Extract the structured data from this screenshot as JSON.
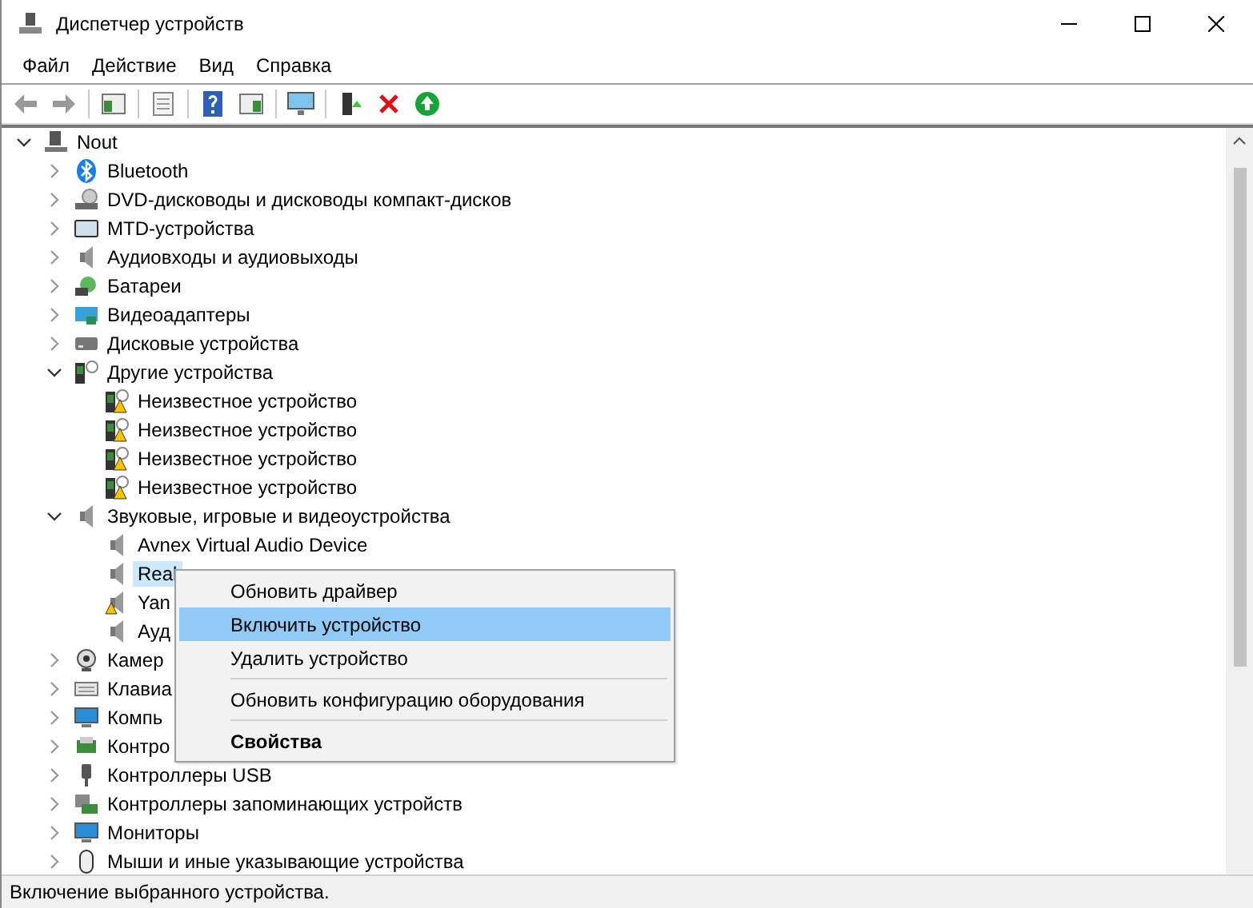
{
  "window": {
    "title": "Диспетчер устройств"
  },
  "menu": [
    "Файл",
    "Действие",
    "Вид",
    "Справка"
  ],
  "toolbar": [
    {
      "kind": "back",
      "disabled": true
    },
    {
      "kind": "forward",
      "disabled": true
    },
    {
      "kind": "sep"
    },
    {
      "kind": "panel"
    },
    {
      "kind": "sep"
    },
    {
      "kind": "sheet"
    },
    {
      "kind": "sep"
    },
    {
      "kind": "help"
    },
    {
      "kind": "panel2"
    },
    {
      "kind": "sep"
    },
    {
      "kind": "monitor"
    },
    {
      "kind": "sep"
    },
    {
      "kind": "driver"
    },
    {
      "kind": "remove"
    },
    {
      "kind": "enable"
    }
  ],
  "tree": [
    {
      "label": "Nout",
      "kind": "computer",
      "expanded": true,
      "selected": false,
      "children": [
        {
          "label": "Bluetooth",
          "kind": "bluetooth",
          "expanded": false,
          "selected": false
        },
        {
          "label": "DVD-дисководы и дисководы компакт-дисков",
          "kind": "dvd",
          "expanded": false,
          "selected": false
        },
        {
          "label": "MTD-устройства",
          "kind": "mtd",
          "expanded": false,
          "selected": false
        },
        {
          "label": "Аудиовходы и аудиовыходы",
          "kind": "speaker",
          "expanded": false,
          "selected": false
        },
        {
          "label": "Батареи",
          "kind": "battery",
          "expanded": false,
          "selected": false
        },
        {
          "label": "Видеоадаптеры",
          "kind": "display",
          "expanded": false,
          "selected": false
        },
        {
          "label": "Дисковые устройства",
          "kind": "disk",
          "expanded": false,
          "selected": false
        },
        {
          "label": "Другие устройства",
          "kind": "unknown",
          "expanded": true,
          "selected": false,
          "children": [
            {
              "label": "Неизвестное устройство",
              "kind": "unknown-warning",
              "selected": false
            },
            {
              "label": "Неизвестное устройство",
              "kind": "unknown-warning",
              "selected": false
            },
            {
              "label": "Неизвестное устройство",
              "kind": "unknown-warning",
              "selected": false
            },
            {
              "label": "Неизвестное устройство",
              "kind": "unknown-warning",
              "selected": false
            }
          ]
        },
        {
          "label": "Звуковые, игровые и видеоустройства",
          "kind": "speaker",
          "expanded": true,
          "selected": false,
          "children": [
            {
              "label": "Avnex Virtual Audio Device",
              "kind": "speaker",
              "selected": false
            },
            {
              "label": "Real",
              "kind": "speaker",
              "selected": true
            },
            {
              "label": "Yan",
              "kind": "speaker-warning",
              "selected": false
            },
            {
              "label": "Ауд",
              "kind": "speaker",
              "selected": false
            }
          ]
        },
        {
          "label": "Камер",
          "kind": "camera",
          "expanded": false,
          "selected": false
        },
        {
          "label": "Клавиа",
          "kind": "keyboard",
          "expanded": false,
          "selected": false
        },
        {
          "label": "Компь",
          "kind": "monitor",
          "expanded": false,
          "selected": false
        },
        {
          "label": "Контро",
          "kind": "board",
          "expanded": false,
          "selected": false
        },
        {
          "label": "Контроллеры USB",
          "kind": "usb",
          "expanded": false,
          "selected": false
        },
        {
          "label": "Контроллеры запоминающих устройств",
          "kind": "storage",
          "expanded": false,
          "selected": false
        },
        {
          "label": "Мониторы",
          "kind": "monitor",
          "expanded": false,
          "selected": false
        },
        {
          "label": "Мыши и иные указывающие устройства",
          "kind": "mouse",
          "expanded": false,
          "selected": false
        }
      ]
    }
  ],
  "context_menu": [
    {
      "kind": "item",
      "label": "Обновить драйвер",
      "selected": false
    },
    {
      "kind": "item",
      "label": "Включить устройство",
      "selected": true
    },
    {
      "kind": "item",
      "label": "Удалить устройство",
      "selected": false
    },
    {
      "kind": "separator"
    },
    {
      "kind": "item",
      "label": "Обновить конфигурацию оборудования",
      "selected": false
    },
    {
      "kind": "separator"
    },
    {
      "kind": "bold",
      "label": "Свойства",
      "selected": false
    }
  ],
  "status_bar": "Включение выбранного устройства."
}
